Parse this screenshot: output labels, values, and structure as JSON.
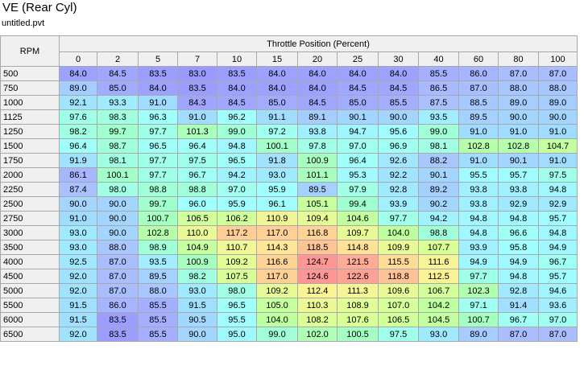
{
  "title": "VE (Rear Cyl)",
  "subtitle": "untitled.pvt",
  "table": {
    "corner_label": "RPM",
    "column_axis_label": "Throttle Position (Percent)",
    "columns": [
      "0",
      "2",
      "5",
      "7",
      "10",
      "15",
      "20",
      "25",
      "30",
      "40",
      "60",
      "80",
      "100"
    ],
    "rows": [
      {
        "rpm": "500",
        "values": [
          "84.0",
          "84.5",
          "83.5",
          "83.0",
          "83.5",
          "84.0",
          "84.0",
          "84.0",
          "84.0",
          "85.5",
          "86.0",
          "87.0",
          "87.0"
        ]
      },
      {
        "rpm": "750",
        "values": [
          "89.0",
          "85.0",
          "84.0",
          "83.5",
          "84.0",
          "84.0",
          "84.0",
          "84.5",
          "84.5",
          "86.5",
          "87.0",
          "88.0",
          "88.0"
        ]
      },
      {
        "rpm": "1000",
        "values": [
          "92.1",
          "93.3",
          "91.0",
          "84.3",
          "84.5",
          "85.0",
          "84.5",
          "85.0",
          "85.5",
          "87.5",
          "88.5",
          "89.0",
          "89.0"
        ]
      },
      {
        "rpm": "1125",
        "values": [
          "97.6",
          "98.3",
          "96.3",
          "91.0",
          "96.2",
          "91.1",
          "89.1",
          "90.1",
          "90.0",
          "93.5",
          "89.5",
          "90.0",
          "90.0"
        ]
      },
      {
        "rpm": "1250",
        "values": [
          "98.2",
          "99.7",
          "97.7",
          "101.3",
          "99.0",
          "97.2",
          "93.8",
          "94.7",
          "95.6",
          "99.0",
          "91.0",
          "91.0",
          "91.0"
        ]
      },
      {
        "rpm": "1500",
        "values": [
          "96.4",
          "98.7",
          "96.5",
          "96.4",
          "94.8",
          "100.1",
          "97.8",
          "97.0",
          "96.9",
          "98.1",
          "102.8",
          "102.8",
          "104.7"
        ]
      },
      {
        "rpm": "1750",
        "values": [
          "91.9",
          "98.1",
          "97.7",
          "97.5",
          "96.5",
          "91.8",
          "100.9",
          "96.4",
          "92.6",
          "88.2",
          "91.0",
          "90.1",
          "91.0"
        ]
      },
      {
        "rpm": "2000",
        "values": [
          "86.1",
          "100.1",
          "97.7",
          "96.7",
          "94.2",
          "93.0",
          "101.1",
          "95.3",
          "92.2",
          "90.1",
          "95.5",
          "95.7",
          "97.5"
        ]
      },
      {
        "rpm": "2250",
        "values": [
          "87.4",
          "98.0",
          "98.8",
          "98.8",
          "97.0",
          "95.9",
          "89.5",
          "97.9",
          "92.8",
          "89.2",
          "93.8",
          "93.8",
          "94.8"
        ]
      },
      {
        "rpm": "2500",
        "values": [
          "90.0",
          "90.0",
          "99.7",
          "96.0",
          "95.9",
          "96.1",
          "105.1",
          "99.4",
          "93.9",
          "90.2",
          "93.8",
          "92.9",
          "92.9"
        ]
      },
      {
        "rpm": "2750",
        "values": [
          "91.0",
          "90.0",
          "100.7",
          "106.5",
          "106.2",
          "110.9",
          "109.4",
          "104.6",
          "97.7",
          "94.2",
          "94.8",
          "94.8",
          "95.7"
        ]
      },
      {
        "rpm": "3000",
        "values": [
          "93.0",
          "90.0",
          "102.8",
          "110.0",
          "117.2",
          "117.0",
          "116.8",
          "109.7",
          "104.0",
          "98.8",
          "94.8",
          "96.6",
          "94.8"
        ]
      },
      {
        "rpm": "3500",
        "values": [
          "93.0",
          "88.0",
          "98.9",
          "104.9",
          "110.7",
          "114.3",
          "118.5",
          "114.8",
          "109.9",
          "107.7",
          "93.9",
          "95.8",
          "94.9"
        ]
      },
      {
        "rpm": "4000",
        "values": [
          "92.5",
          "87.0",
          "93.5",
          "100.9",
          "109.2",
          "116.6",
          "124.7",
          "121.5",
          "115.5",
          "111.6",
          "94.9",
          "94.9",
          "96.7"
        ]
      },
      {
        "rpm": "4500",
        "values": [
          "92.0",
          "87.0",
          "89.5",
          "98.2",
          "107.5",
          "117.0",
          "124.6",
          "122.6",
          "118.8",
          "112.5",
          "97.7",
          "94.8",
          "95.7"
        ]
      },
      {
        "rpm": "5000",
        "values": [
          "92.0",
          "87.0",
          "88.0",
          "93.0",
          "98.0",
          "109.2",
          "112.4",
          "111.3",
          "109.6",
          "106.7",
          "102.3",
          "92.8",
          "94.6"
        ]
      },
      {
        "rpm": "5500",
        "values": [
          "91.5",
          "86.0",
          "85.5",
          "91.5",
          "96.5",
          "105.0",
          "110.3",
          "108.9",
          "107.0",
          "104.2",
          "97.1",
          "91.4",
          "93.6"
        ]
      },
      {
        "rpm": "6000",
        "values": [
          "91.5",
          "83.5",
          "85.5",
          "90.5",
          "95.5",
          "104.0",
          "108.2",
          "107.6",
          "106.5",
          "104.5",
          "100.7",
          "96.7",
          "97.0"
        ]
      },
      {
        "rpm": "6500",
        "values": [
          "92.0",
          "83.5",
          "85.5",
          "90.0",
          "95.0",
          "99.0",
          "102.0",
          "100.5",
          "97.5",
          "93.0",
          "89.0",
          "87.0",
          "87.0"
        ]
      }
    ]
  }
}
